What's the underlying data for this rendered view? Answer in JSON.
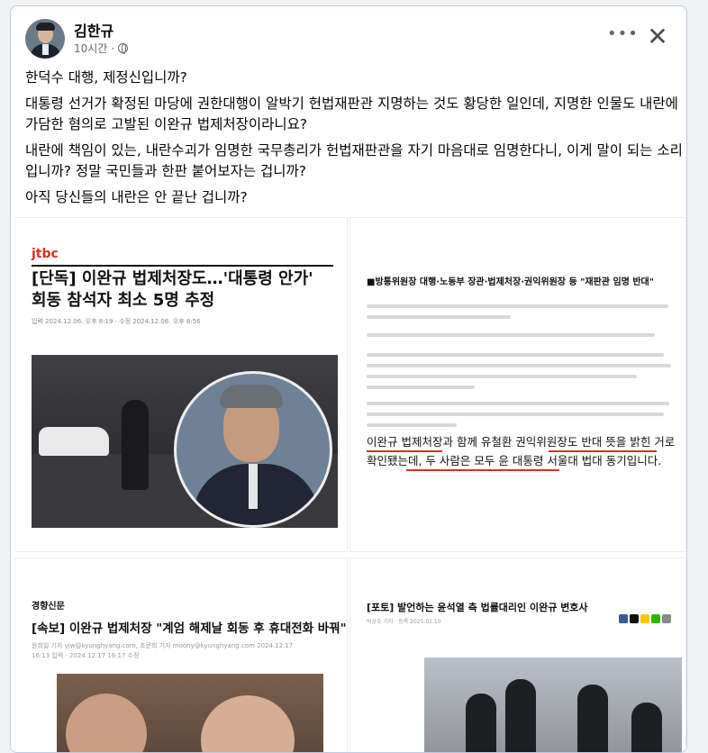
{
  "post": {
    "author": "김한규",
    "time": "10시간",
    "separator": "·",
    "more_label": "•••",
    "close_label": "✕",
    "paragraphs": [
      "한덕수 대행, 제정신입니까?",
      "대통령 선거가 확정된 마당에 권한대행이 알박기 헌법재판관 지명하는 것도 황당한 일인데, 지명한 인물도 내란에 가담한 혐의로 고발된 이완규 법제처장이라니요?",
      "내란에 책임이 있는, 내란수괴가 임명한 국무총리가 헌법재판관을 자기 마음대로 임명한다니, 이게 말이 되는 소리입니까? 정말 국민들과 한판 붙어보자는 겁니까?",
      "아직 당신들의 내란은 안 끝난 겁니까?"
    ]
  },
  "photos": {
    "p1": {
      "brand": "jtbc",
      "headline": "[단독] 이완규 법제처장도…'대통령 안가' 회동 참석자 최소 5명 추정",
      "meta": "입력 2024.12.06. 오후 8:19 · 수정 2024.12.06. 오후 8:56"
    },
    "p2": {
      "heading": "■방통위원장 대행·노동부 장관·법제처장·권익위원장 등 \"재판관 임명 반대\"",
      "highlight": "이완규 법제처장과 함께 유철환 권익위원장도 반대 뜻을 밝힌 거로 확인됐는데, 두 사람은 모두 윤 대통령 서울대 법대 동기입니다."
    },
    "p3": {
      "logo": "경향신문",
      "headline": "[속보] 이완규 법제처장 \"계엄 해제날 회동 후 휴대전화 바꿔\"",
      "meta": "윤희일 기자 yjw@kyunghyang.com, 조문희 기자 moony@kyunghyang.com 2024.12.17 16:13 입력 · 2024.12.17 16:17 수정"
    },
    "p4": {
      "headline": "[포토] 발언하는 윤석열 측 법률대리인 이완규 변호사",
      "meta": "박상호 기자 · 등록 2025.02.10"
    }
  },
  "colors": {
    "accent_red": "#d93025",
    "card_border": "#b9cde8"
  }
}
